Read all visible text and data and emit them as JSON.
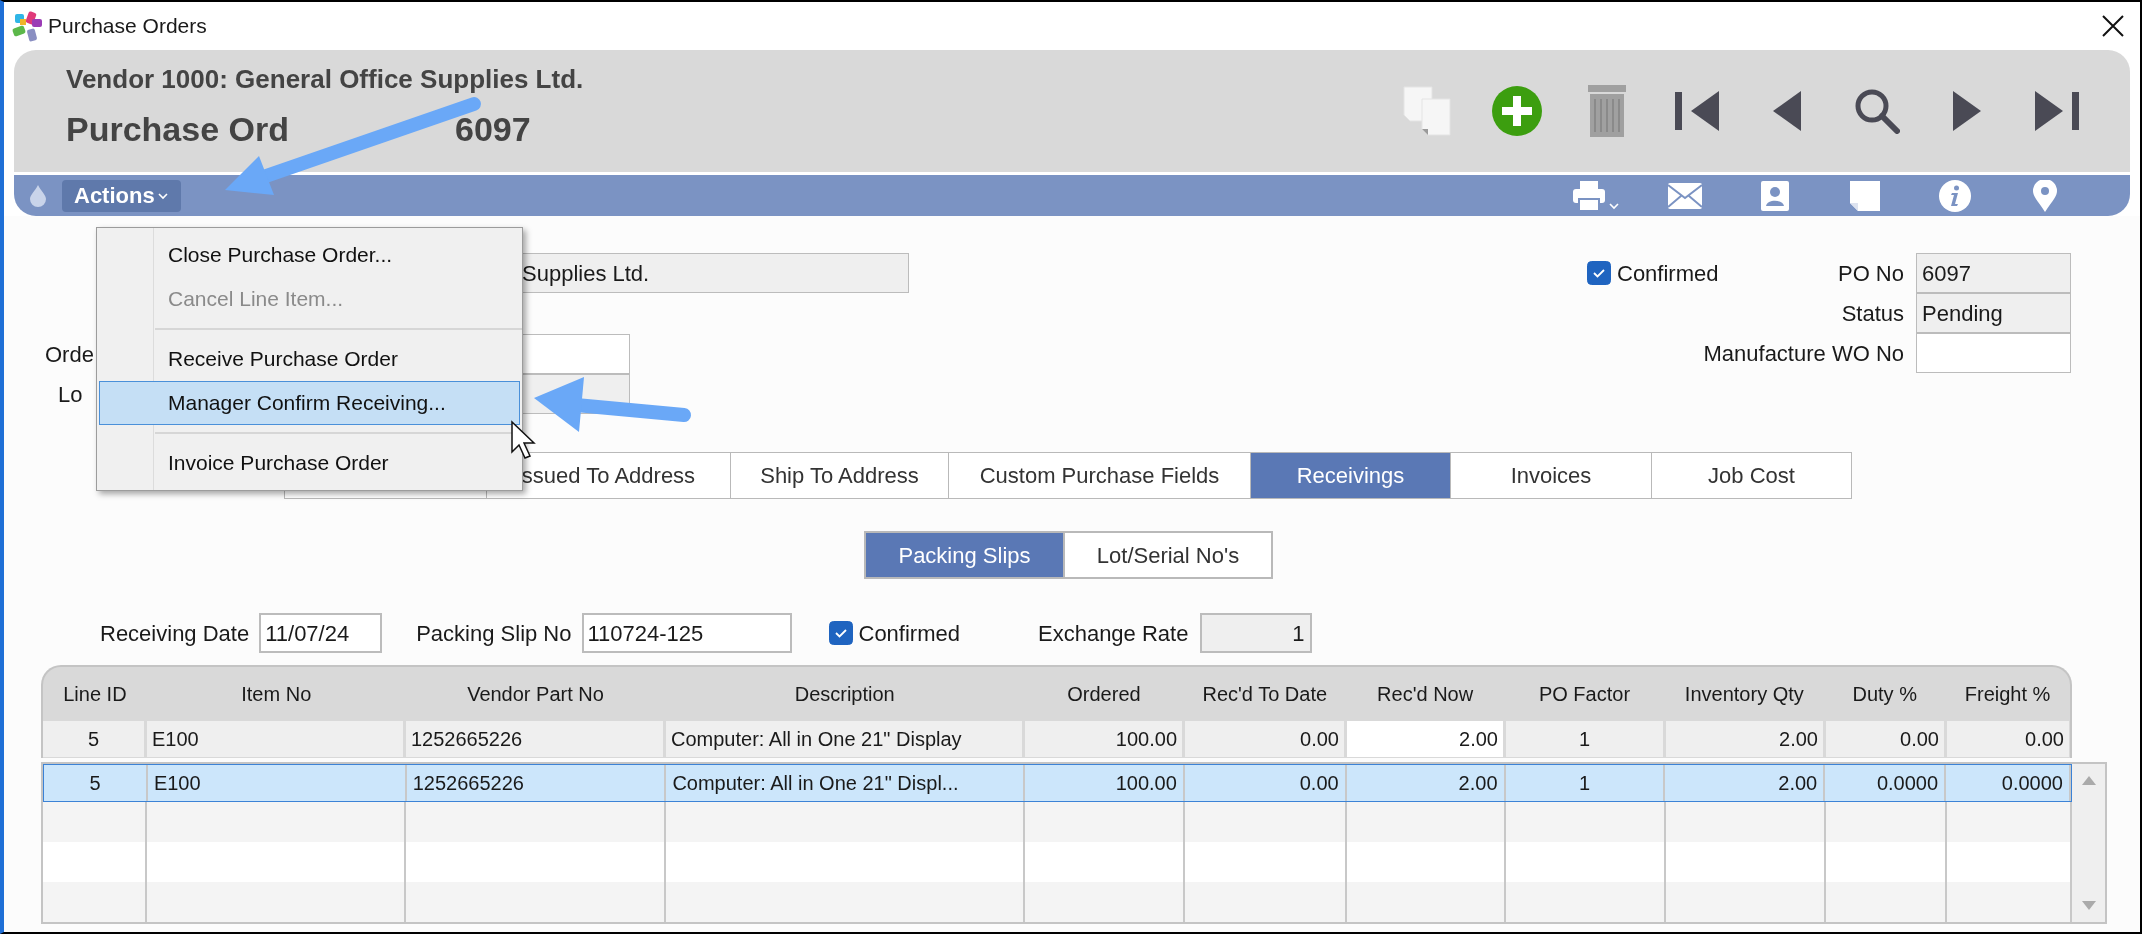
{
  "window": {
    "title": "Purchase Orders"
  },
  "header": {
    "vendor": "Vendor 1000: General Office Supplies Ltd.",
    "title_parts": [
      "Purchase Ord",
      "6097"
    ]
  },
  "header_tools": [
    {
      "kind": "copy",
      "disabled": true
    },
    {
      "kind": "add",
      "disabled": false
    },
    {
      "kind": "delete",
      "disabled": true
    },
    {
      "kind": "first",
      "disabled": false
    },
    {
      "kind": "previous",
      "disabled": false
    },
    {
      "kind": "search",
      "disabled": false
    },
    {
      "kind": "next",
      "disabled": false
    },
    {
      "kind": "last",
      "disabled": false
    }
  ],
  "toolbar": {
    "actions_label": "Actions",
    "tools": [
      {
        "kind": "print",
        "has_menu": true
      },
      {
        "kind": "email",
        "has_menu": false
      },
      {
        "kind": "contact",
        "has_menu": false
      },
      {
        "kind": "note",
        "has_menu": false
      },
      {
        "kind": "info",
        "has_menu": false
      },
      {
        "kind": "location",
        "has_menu": false
      }
    ]
  },
  "actions_menu": {
    "items": [
      {
        "label": "Close Purchase Order...",
        "disabled": false,
        "selected": false,
        "separator_before": false
      },
      {
        "label": "Cancel Line Item...",
        "disabled": true,
        "selected": false,
        "separator_before": false
      },
      {
        "label": "Receive Purchase Order",
        "disabled": false,
        "selected": false,
        "separator_before": true
      },
      {
        "label": "Manager Confirm Receiving...",
        "disabled": false,
        "selected": true,
        "separator_before": false
      },
      {
        "label": "Invoice Purchase Order",
        "disabled": false,
        "selected": false,
        "separator_before": true
      }
    ]
  },
  "form": {
    "vendor_value": "Supplies Ltd.",
    "order_label": "Orde",
    "location_label": "Lo",
    "confirmed": {
      "label": "Confirmed",
      "checked": true
    },
    "fields": [
      {
        "label": "PO No",
        "value": "6097",
        "readonly": true
      },
      {
        "label": "Status",
        "value": "Pending",
        "readonly": true
      },
      {
        "label": "Manufacture WO No",
        "readonly": false
      }
    ]
  },
  "tabs": [
    {
      "selected": false
    },
    {
      "label": "ssued To Address",
      "selected": false
    },
    {
      "label": "Ship To Address",
      "selected": false
    },
    {
      "label": "Custom Purchase Fields",
      "selected": false
    },
    {
      "label": "Receivings",
      "selected": true
    },
    {
      "label": "Invoices",
      "selected": false
    },
    {
      "label": "Job Cost",
      "selected": false
    }
  ],
  "subtabs": [
    {
      "label": "Packing Slips",
      "selected": true
    },
    {
      "label": "Lot/Serial No's",
      "selected": false
    }
  ],
  "receiving": {
    "date": {
      "label": "Receiving Date",
      "value": "11/07/24"
    },
    "packing_slip": {
      "label": "Packing Slip No",
      "value": "110724-125"
    },
    "confirmed": {
      "label": "Confirmed",
      "checked": true
    },
    "exchange_rate": {
      "label": "Exchange Rate",
      "value": "1"
    }
  },
  "table": {
    "columns": [
      {
        "label": "Line ID",
        "kind": "center"
      },
      {
        "label": "Item No",
        "kind": "text"
      },
      {
        "label": "Vendor Part No",
        "kind": "text"
      },
      {
        "label": "Description",
        "kind": "text"
      },
      {
        "label": "Ordered",
        "kind": "number"
      },
      {
        "label": "Rec'd To Date",
        "kind": "number"
      },
      {
        "label": "Rec'd Now",
        "kind": "number"
      },
      {
        "label": "PO Factor",
        "kind": "center"
      },
      {
        "label": "Inventory Qty",
        "kind": "number"
      },
      {
        "label": "Duty %",
        "kind": "number"
      },
      {
        "label": "Freight %",
        "kind": "number"
      }
    ],
    "edit_row": [
      {
        "value": "5",
        "editable": false
      },
      {
        "value": "E100",
        "editable": false
      },
      {
        "value": "1252665226",
        "editable": false
      },
      {
        "value": "Computer: All in One 21\" Display",
        "editable": false
      },
      {
        "value": "100.00",
        "editable": false
      },
      {
        "value": "0.00",
        "editable": false
      },
      {
        "value": "2.00",
        "editable": true
      },
      {
        "value": "1",
        "editable": false
      },
      {
        "value": "2.00",
        "editable": false
      },
      {
        "value": "0.00",
        "editable": false
      },
      {
        "value": "0.00",
        "editable": false
      }
    ],
    "rows": [
      {
        "selected": true,
        "cells": [
          "5",
          "E100",
          "1252665226",
          "Computer: All in One 21\" Displ...",
          "100.00",
          "0.00",
          "2.00",
          "1",
          "2.00",
          "0.0000",
          "0.0000"
        ]
      }
    ]
  }
}
